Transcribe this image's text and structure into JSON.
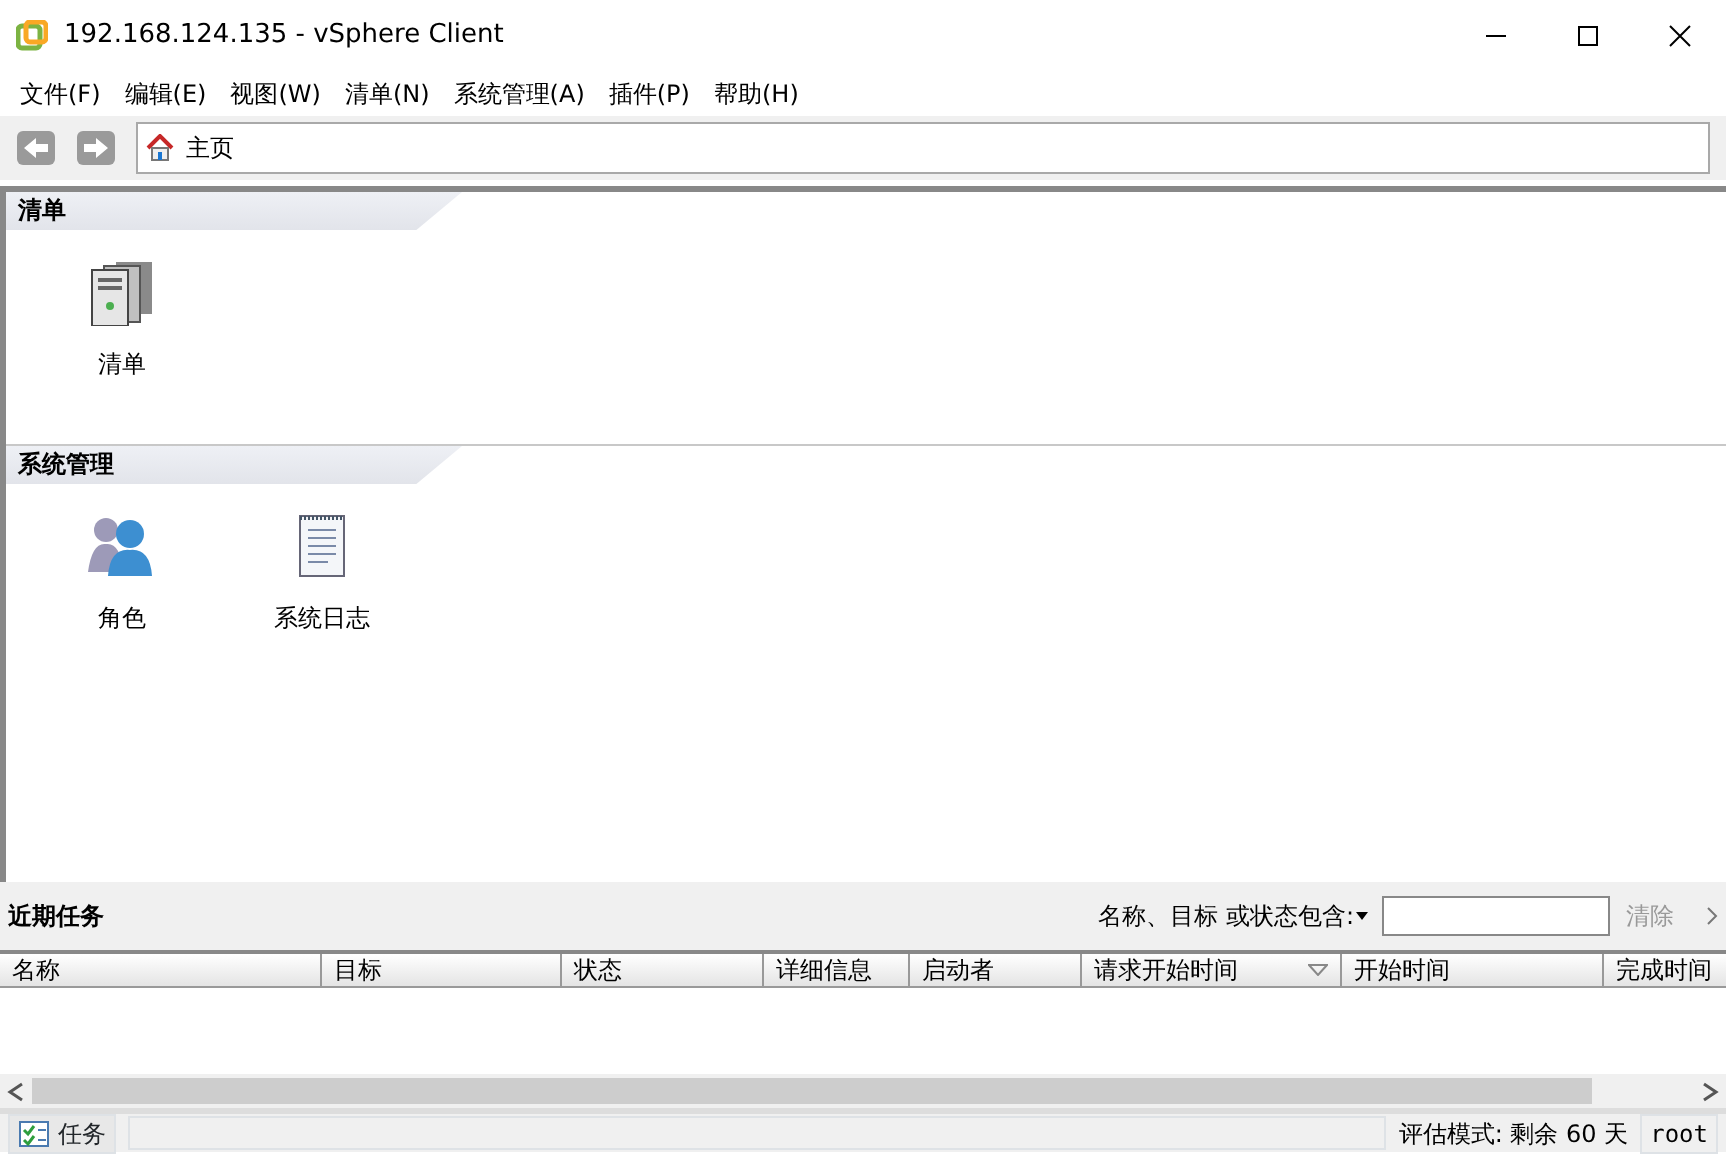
{
  "window": {
    "title": "192.168.124.135 - vSphere Client"
  },
  "menu": [
    "文件(F)",
    "编辑(E)",
    "视图(W)",
    "清单(N)",
    "系统管理(A)",
    "插件(P)",
    "帮助(H)"
  ],
  "address_bar": {
    "location": "主页"
  },
  "sections": [
    {
      "title": "清单",
      "items": [
        {
          "label": "清单",
          "kind": "servers"
        }
      ]
    },
    {
      "title": "系统管理",
      "items": [
        {
          "label": "角色",
          "kind": "users"
        },
        {
          "label": "系统日志",
          "kind": "log"
        }
      ]
    }
  ],
  "recent_tasks": {
    "title": "近期任务",
    "filter_label": "名称、目标 或状态包含:",
    "clear_button": "清除",
    "columns": [
      {
        "label": "名称",
        "sorted": false
      },
      {
        "label": "目标",
        "sorted": false
      },
      {
        "label": "状态",
        "sorted": false
      },
      {
        "label": "详细信息",
        "sorted": false
      },
      {
        "label": "启动者",
        "sorted": false
      },
      {
        "label": "请求开始时间",
        "sorted": true
      },
      {
        "label": "开始时间",
        "sorted": false
      },
      {
        "label": "完成时间",
        "sorted": false
      }
    ]
  },
  "status_bar": {
    "tasks_button": "任务",
    "license": "评估模式: 剩余 60 天",
    "user": "root"
  }
}
